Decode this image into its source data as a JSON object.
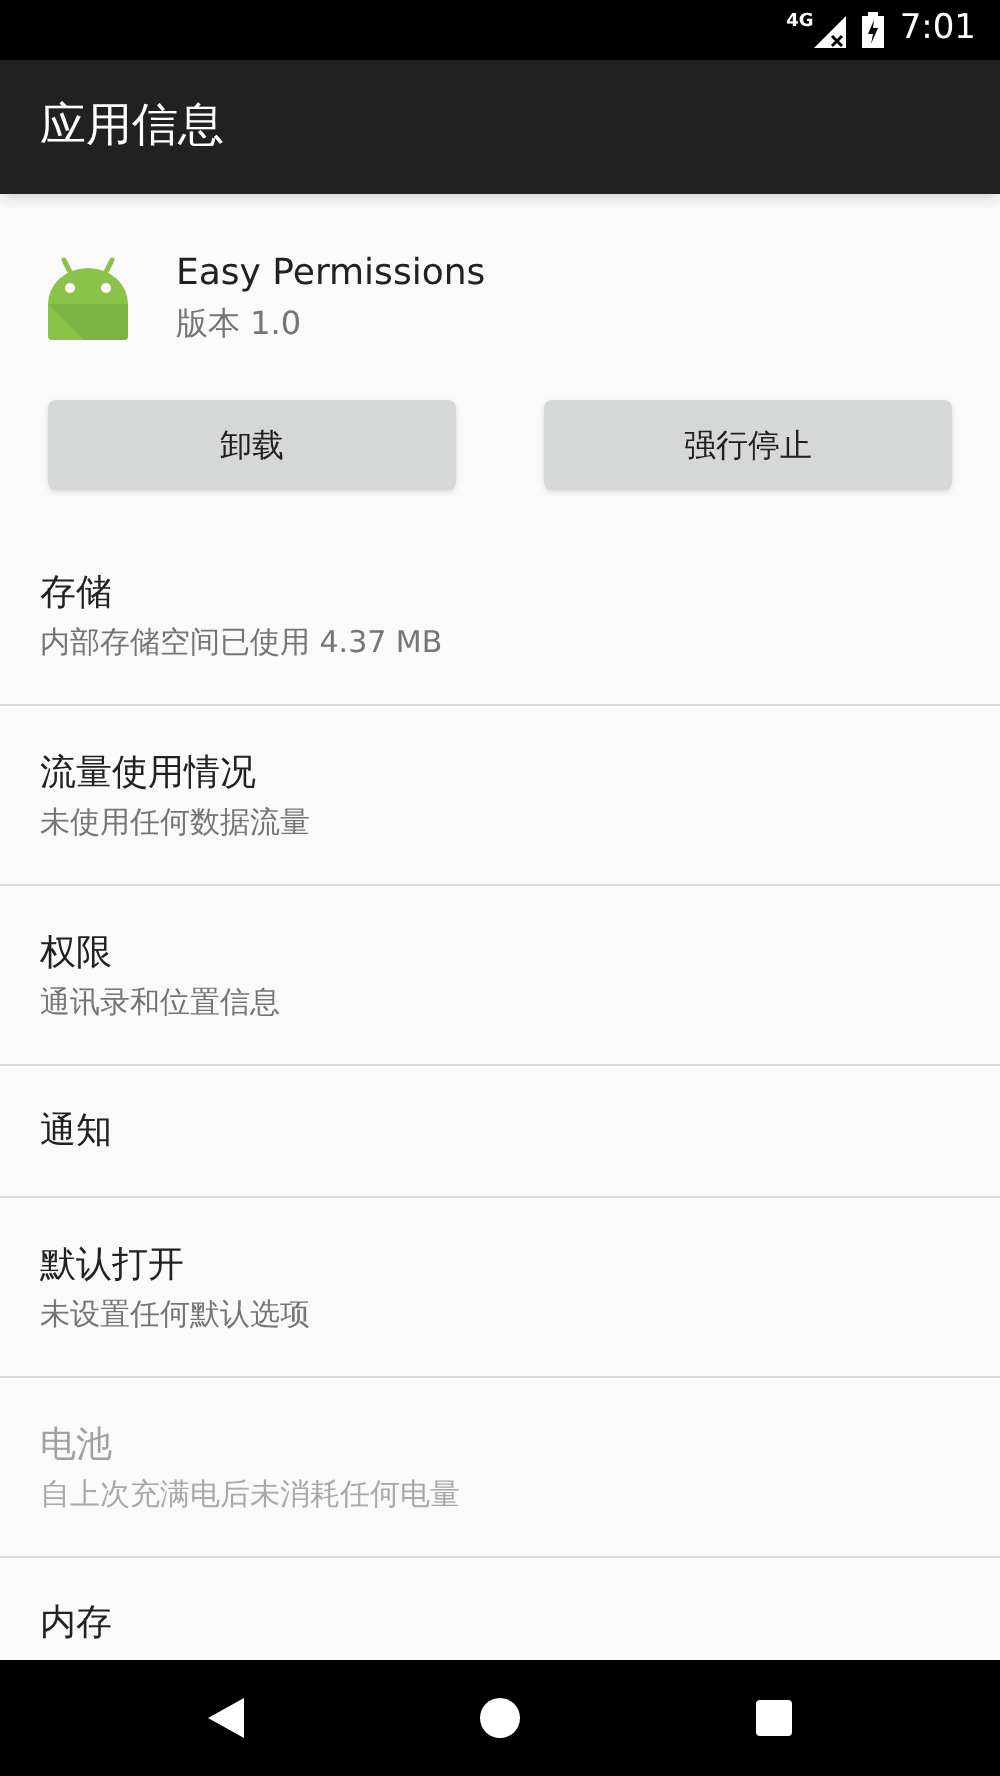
{
  "status_bar": {
    "network": "4G",
    "time": "7:01"
  },
  "toolbar": {
    "title": "应用信息"
  },
  "app": {
    "name": "Easy Permissions",
    "version": "版本 1.0"
  },
  "buttons": [
    "卸载",
    "强行停止"
  ],
  "settings": [
    {
      "title": "存储",
      "subtitle": "内部存储空间已使用 4.37 MB",
      "disabled": false
    },
    {
      "title": "流量使用情况",
      "subtitle": "未使用任何数据流量",
      "disabled": false
    },
    {
      "title": "权限",
      "subtitle": "通讯录和位置信息",
      "disabled": false
    },
    {
      "title": "通知",
      "disabled": false
    },
    {
      "title": "默认打开",
      "subtitle": "未设置任何默认选项",
      "disabled": false
    },
    {
      "title": "电池",
      "subtitle": "自上次充满电后未消耗任何电量",
      "disabled": true
    },
    {
      "title": "内存",
      "disabled": false
    }
  ]
}
